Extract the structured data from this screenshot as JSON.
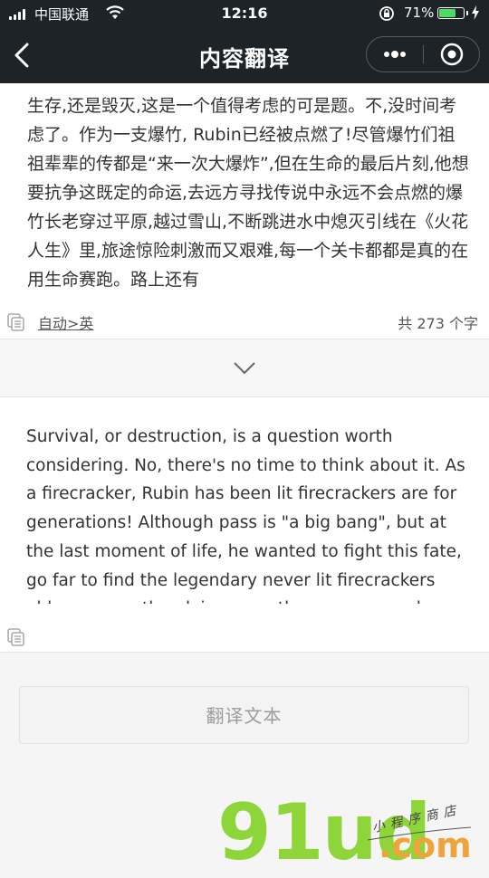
{
  "status_bar": {
    "carrier": "中国联通",
    "time": "12:16",
    "battery_percent": "71%",
    "battery_level": 0.71
  },
  "nav": {
    "title": "内容翻译"
  },
  "source": {
    "text": "生存,还是毁灭,这是一个值得考虑的可是题。不,没时间考虑了。作为一支爆竹, Rubin已经被点燃了!尽管爆竹们祖祖辈辈的传都是“来一次大爆炸”,但在生命的最后片刻,他想要抗争这既定的命运,去远方寻找传说中永远不会点燃的爆竹长老穿过平原,越过雪山,不断跳进水中熄灭引线在《火花人生》里,旅途惊险刺激而又艰难,每一个关卡都都是真的在用生命赛跑。路上还有",
    "language_label": "自动>英",
    "char_count": "共 273 个字"
  },
  "target": {
    "text": "Survival, or destruction, is a question worth considering. No, there's no time to think about it. As a firecracker, Rubin has been lit firecrackers are for generations! Although pass is \"a big bang\", but at the last moment of life, he wanted to fight this fate, go far to find the legendary never lit firecrackers elders across the plains, over the snow capped"
  },
  "actions": {
    "translate_label": "翻译文本"
  },
  "colors": {
    "navbar": "#1e2328",
    "battery": "#4cd964",
    "watermark_green": "#8ed53a",
    "watermark_orange": "#f2a23b"
  },
  "icons": [
    "back-icon",
    "more-dots-icon",
    "close-target-icon",
    "copy-icon",
    "chevron-down-icon",
    "wifi-icon",
    "lock-rotation-icon",
    "charging-bolt-icon"
  ]
}
